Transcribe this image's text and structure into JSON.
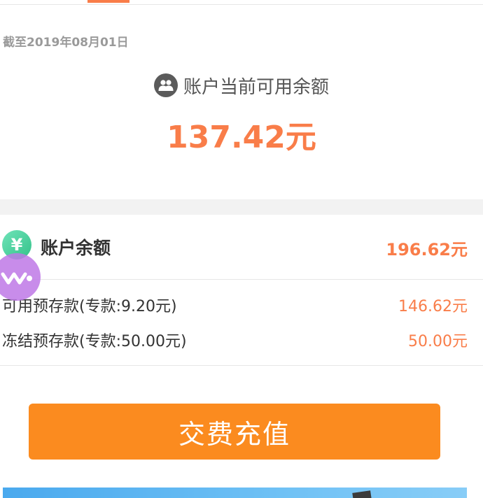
{
  "header": {
    "as_of_date": "截至2019年08月01日"
  },
  "available": {
    "icon": "people-icon",
    "label": "账户当前可用余额",
    "amount": "137.42元"
  },
  "account_balance": {
    "icon": "yen-icon",
    "icon_glyph": "¥",
    "title": "账户余额",
    "value": "196.62元"
  },
  "details": [
    {
      "label": "可用预存款(专款:9.20元)",
      "value": "146.62元"
    },
    {
      "label": "冻结预存款(专款:50.00元)",
      "value": "50.00元"
    }
  ],
  "actions": {
    "pay_label": "交费充值"
  },
  "colors": {
    "accent": "#f97d49",
    "button": "#fb8b1f",
    "band": "#f2f2f2"
  }
}
